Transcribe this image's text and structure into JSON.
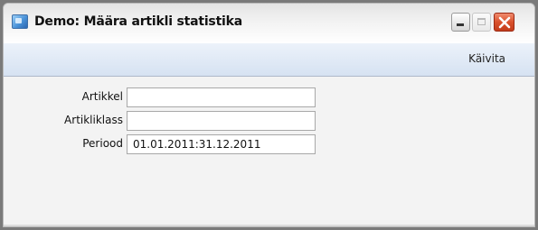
{
  "window": {
    "title": "Demo: Määra artikli statistika"
  },
  "toolbar": {
    "run_label": "Käivita"
  },
  "form": {
    "article_label": "Artikkel",
    "article_value": "",
    "class_label": "Artikliklass",
    "class_value": "",
    "period_label": "Periood",
    "period_value": "01.01.2011:31.12.2011"
  },
  "icons": {
    "app": "app-window-icon",
    "minimize": "minimize-icon",
    "maximize": "maximize-icon",
    "close": "close-icon"
  },
  "colors": {
    "close_button": "#d9512c",
    "toolbar": "#dbe6f4"
  }
}
